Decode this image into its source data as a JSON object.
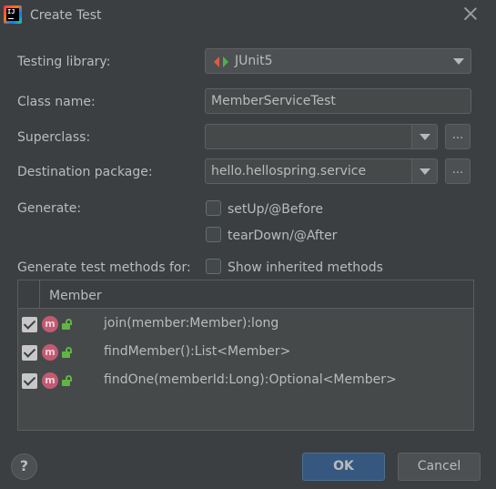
{
  "window": {
    "title": "Create Test"
  },
  "form": {
    "testing_library_label": "Testing library:",
    "testing_library_value": "JUnit5",
    "class_name_label": "Class name:",
    "class_name_value": "MemberServiceTest",
    "superclass_label": "Superclass:",
    "superclass_value": "",
    "superclass_browse": "...",
    "destination_label": "Destination package:",
    "destination_value": "hello.hellospring.service",
    "destination_browse": "...",
    "generate_label": "Generate:",
    "setup_label": "setUp/@Before",
    "setup_checked": false,
    "teardown_label": "tearDown/@After",
    "teardown_checked": false,
    "methods_label": "Generate test methods for:",
    "show_inherited_label": "Show inherited methods",
    "show_inherited_checked": false
  },
  "table": {
    "column_header": "Member",
    "rows": [
      {
        "icon": "m",
        "signature": "join(member:Member):long",
        "checked": true
      },
      {
        "icon": "m",
        "signature": "findMember():List<Member>",
        "checked": true
      },
      {
        "icon": "m",
        "signature": "findOne(memberId:Long):Optional<Member>",
        "checked": true
      }
    ]
  },
  "footer": {
    "help_label": "?",
    "ok_label": "OK",
    "cancel_label": "Cancel"
  },
  "colors": {
    "background": "#3c3f41",
    "primary_button": "#365880",
    "method_icon": "#c15a72",
    "lock_icon": "#62b543"
  }
}
